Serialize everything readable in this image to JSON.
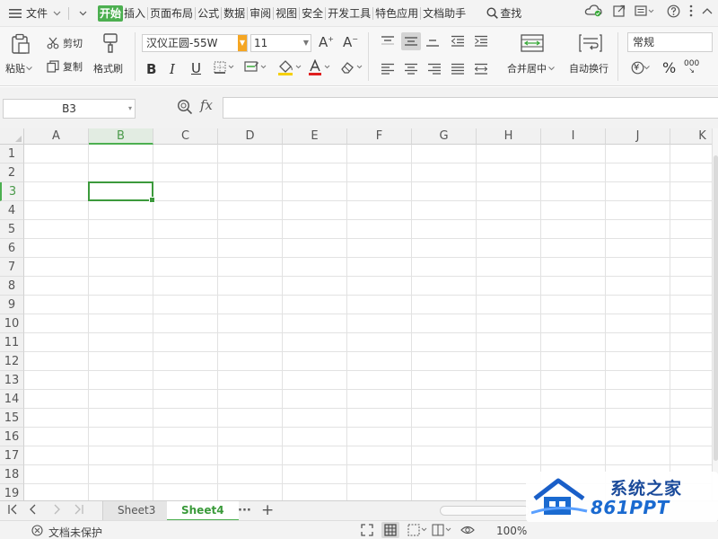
{
  "menubar": {
    "file_label": "文件",
    "tabs": [
      "开始",
      "插入",
      "页面布局",
      "公式",
      "数据",
      "审阅",
      "视图",
      "安全",
      "开发工具",
      "特色应用",
      "文档助手"
    ],
    "active_tab": "开始",
    "search_label": "查找"
  },
  "ribbon": {
    "paste_label": "粘贴",
    "cut_label": "剪切",
    "copy_label": "复制",
    "format_painter_label": "格式刷",
    "font_name": "汉仪正圆-55W",
    "font_size": "11",
    "merge_center_label": "合并居中",
    "wrap_text_label": "自动换行",
    "number_format": "常规",
    "currency_symbol": "¥",
    "percent_symbol": "%",
    "thousands_symbol": "000",
    "font_color": "#e02020",
    "fill_color": "#f5d000"
  },
  "formula_bar": {
    "name_box": "B3",
    "fx_label": "fx",
    "formula": ""
  },
  "grid": {
    "columns": [
      "A",
      "B",
      "C",
      "D",
      "E",
      "F",
      "G",
      "H",
      "I",
      "J",
      "K"
    ],
    "rows": [
      "1",
      "2",
      "3",
      "4",
      "5",
      "6",
      "7",
      "8",
      "9",
      "10",
      "11",
      "12",
      "13",
      "14",
      "15",
      "16",
      "17",
      "18",
      "19"
    ],
    "selected_column": "B",
    "selected_row": "3"
  },
  "sheets": {
    "tabs": [
      "Sheet3",
      "Sheet4"
    ],
    "active": "Sheet4",
    "more_label": "···",
    "add_label": "+"
  },
  "status": {
    "protection_label": "文档未保护",
    "zoom": "100%"
  },
  "watermark": {
    "cn": "系统之家",
    "en": "861PPT"
  },
  "accent_color": "#4caf50"
}
